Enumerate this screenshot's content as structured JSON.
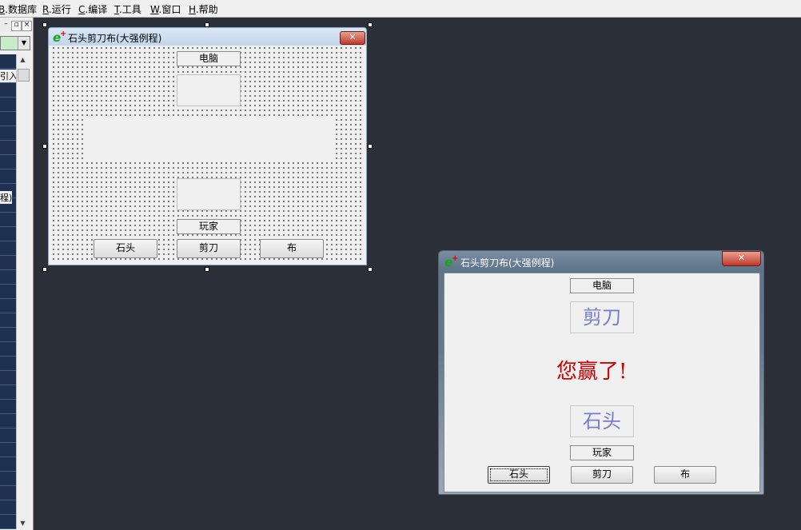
{
  "menu": {
    "items": [
      {
        "key": "B",
        "label": ".数据库"
      },
      {
        "key": "R",
        "label": ".运行"
      },
      {
        "key": "C",
        "label": ".编译"
      },
      {
        "key": "T",
        "label": ".工具"
      },
      {
        "key": "W",
        "label": ".窗口"
      },
      {
        "key": "H",
        "label": ".帮助"
      }
    ]
  },
  "left_panel": {
    "frag_top": "引入",
    "frag_mid": "程)"
  },
  "design_form": {
    "title": "石头剪刀布(大强例程)",
    "computer_label": "电脑",
    "player_label": "玩家",
    "buttons": [
      "石头",
      "剪刀",
      "布"
    ]
  },
  "run_window": {
    "title": "石头剪刀布(大强例程)",
    "computer_label": "电脑",
    "computer_choice": "剪刀",
    "result": "您赢了!",
    "player_choice": "石头",
    "player_label": "玩家",
    "buttons": [
      "石头",
      "剪刀",
      "布"
    ],
    "result_color": "#d00000",
    "choice_color": "#7a7ad0"
  },
  "icons": {
    "app": "e-plus-icon",
    "close": "close-icon"
  }
}
